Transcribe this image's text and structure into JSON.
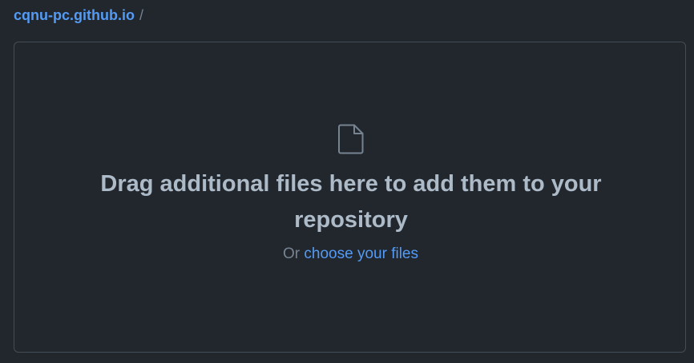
{
  "breadcrumb": {
    "repo": "cqnu-pc.github.io",
    "separator": "/"
  },
  "dropzone": {
    "icon": "file-icon",
    "headline": "Drag additional files here to add them to your repository",
    "or_text": "Or",
    "choose_link": "choose your files"
  },
  "colors": {
    "background": "#22272e",
    "border": "#444c56",
    "link": "#539bf5",
    "text": "#adbac7",
    "muted": "#768390"
  }
}
